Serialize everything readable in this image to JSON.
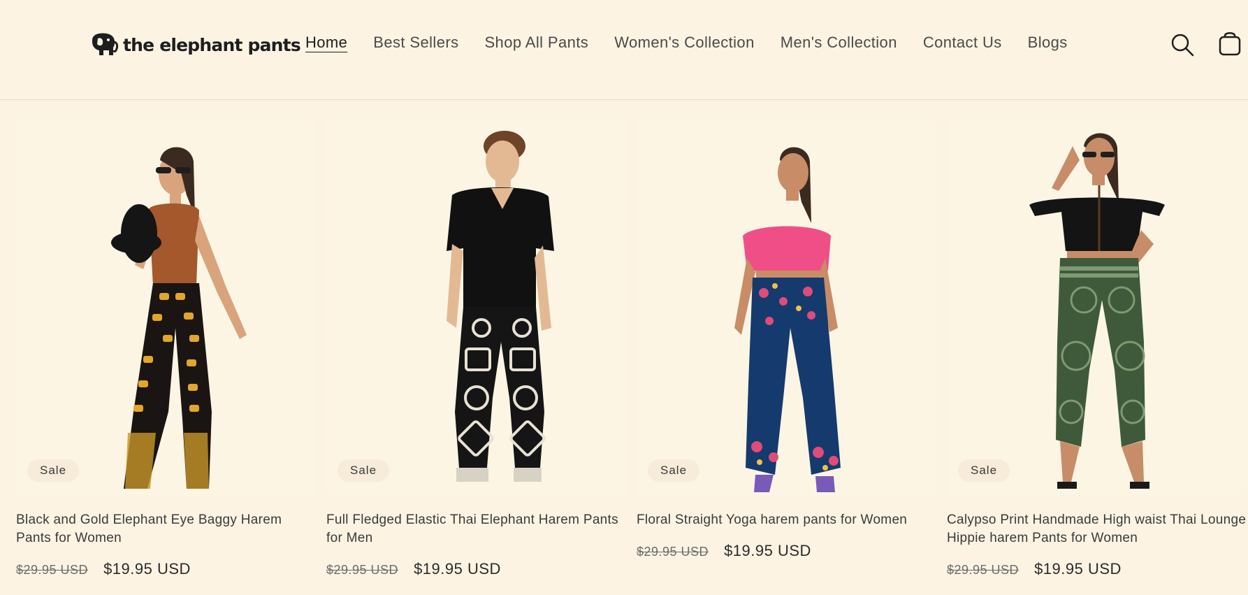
{
  "brand": {
    "name": "the elephant pants"
  },
  "nav": {
    "items": [
      {
        "label": "Home",
        "active": true
      },
      {
        "label": "Best Sellers"
      },
      {
        "label": "Shop All Pants"
      },
      {
        "label": "Women's Collection"
      },
      {
        "label": "Men's Collection"
      },
      {
        "label": "Contact Us"
      },
      {
        "label": "Blogs"
      }
    ]
  },
  "header_icons": {
    "search": "search-icon",
    "cart": "cart-icon"
  },
  "colors": {
    "background": "#fcf3e2",
    "text": "#2b2b2b",
    "badge_bg": "#f6ecd9"
  },
  "products": [
    {
      "badge": "Sale",
      "title": "Black and Gold Elephant Eye Baggy Harem Pants for Women",
      "price_old": "$29.95 USD",
      "price_new": "$19.95 USD"
    },
    {
      "badge": "Sale",
      "title": "Full Fledged Elastic Thai Elephant Harem Pants for Men",
      "price_old": "$29.95 USD",
      "price_new": "$19.95 USD"
    },
    {
      "badge": "Sale",
      "title": "Floral Straight Yoga harem pants for Women",
      "price_old": "$29.95 USD",
      "price_new": "$19.95 USD"
    },
    {
      "badge": "Sale",
      "title": "Calypso Print Handmade High waist Thai Lounge Hippie harem Pants for Women",
      "price_old": "$29.95 USD",
      "price_new": "$19.95 USD"
    }
  ]
}
